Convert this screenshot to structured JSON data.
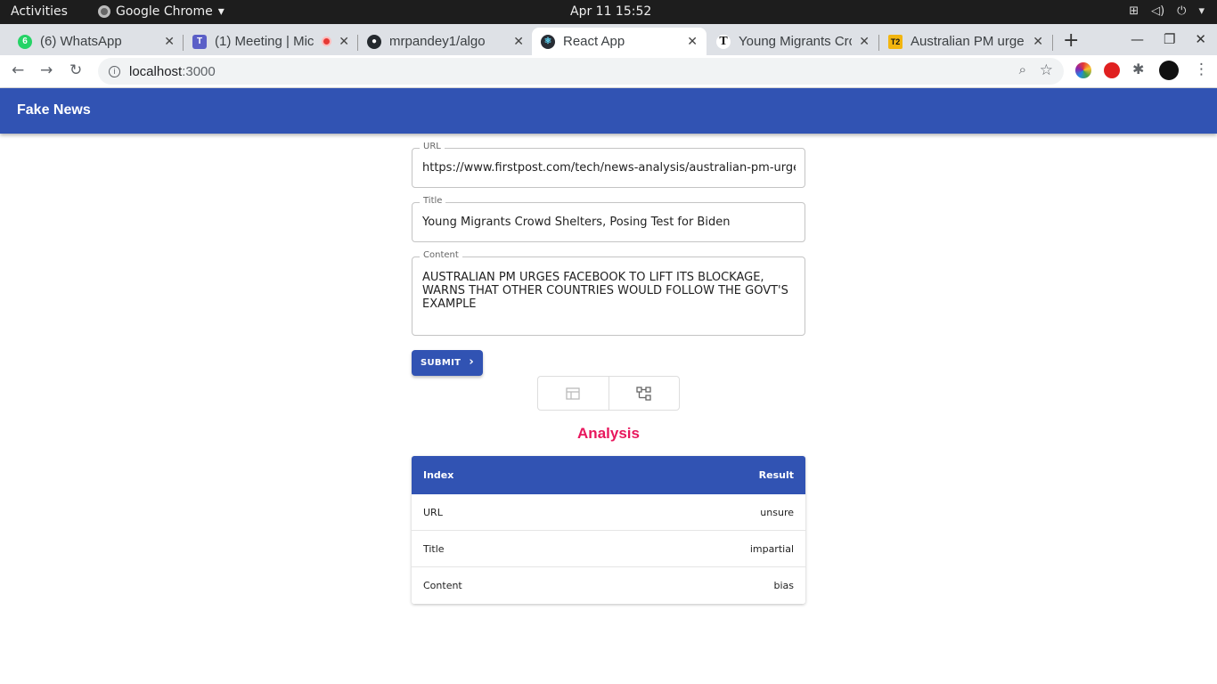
{
  "system": {
    "activities": "Activities",
    "app_name": "Google Chrome",
    "clock": "Apr 11  15:52"
  },
  "tabs": [
    {
      "title": "(6) WhatsApp",
      "badge": "6",
      "color": "#25d366"
    },
    {
      "title": "(1) Meeting | Mic",
      "color": "#5b5fc7"
    },
    {
      "title": "mrpandey1/algo",
      "color": "#24292e"
    },
    {
      "title": "React App",
      "color": "#282c34"
    },
    {
      "title": "Young Migrants Cro",
      "color": "#111111"
    },
    {
      "title": "Australian PM urge",
      "badge": "T2",
      "color": "#f2b50f"
    }
  ],
  "address": {
    "host": "localhost",
    "port": ":3000"
  },
  "app": {
    "brand": "Fake News"
  },
  "form": {
    "url_label": "URL",
    "url_value": "https://www.firstpost.com/tech/news-analysis/australian-pm-urges-facebook",
    "title_label": "Title",
    "title_value": "Young Migrants Crowd Shelters, Posing Test for Biden",
    "content_label": "Content",
    "content_value": "AUSTRALIAN PM URGES FACEBOOK TO LIFT ITS BLOCKAGE, WARNS THAT OTHER COUNTRIES WOULD FOLLOW THE GOVT'S EXAMPLE",
    "submit_label": "SUBMIT"
  },
  "analysis": {
    "title": "Analysis",
    "col_index": "Index",
    "col_result": "Result",
    "rows": [
      {
        "index": "URL",
        "result": "unsure"
      },
      {
        "index": "Title",
        "result": "impartial"
      },
      {
        "index": "Content",
        "result": "bias"
      }
    ]
  }
}
